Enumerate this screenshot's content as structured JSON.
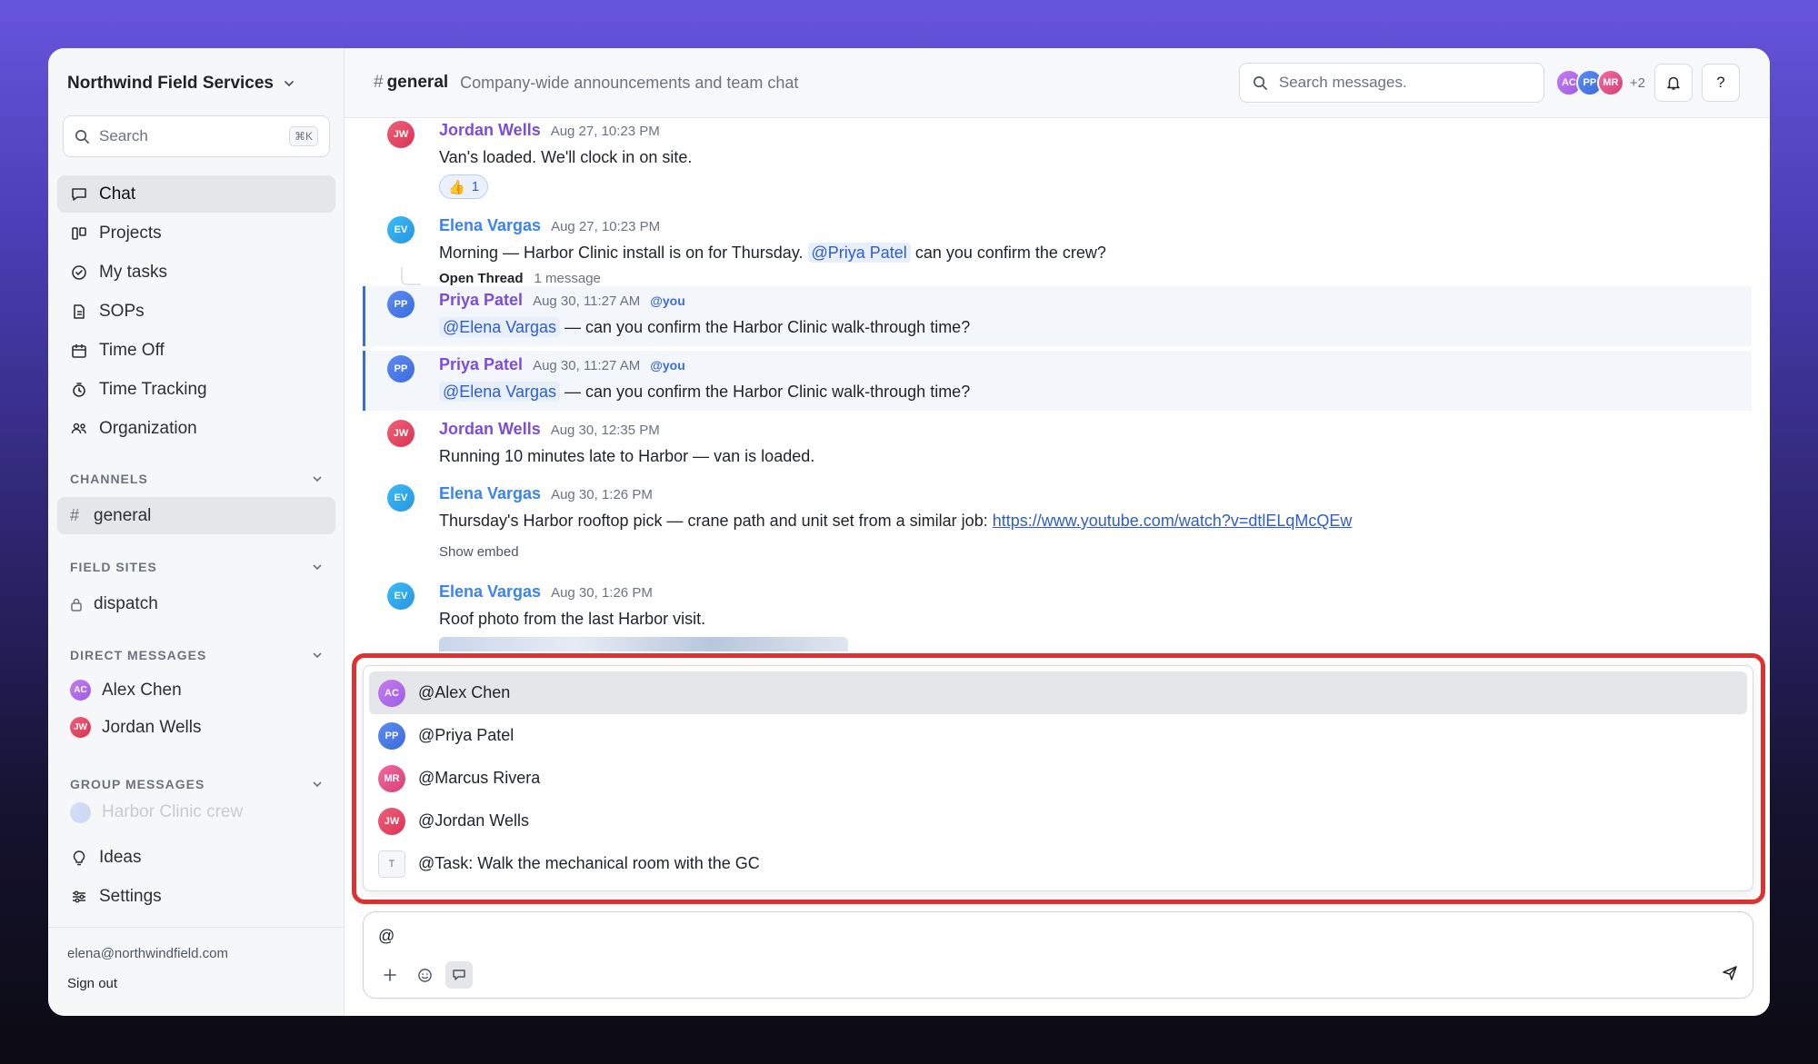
{
  "workspace": {
    "name": "Northwind Field Services"
  },
  "sidebar": {
    "search_placeholder": "Search",
    "search_shortcut": "⌘K",
    "nav": [
      {
        "label": "Chat",
        "icon": "chat-icon"
      },
      {
        "label": "Projects",
        "icon": "projects-icon"
      },
      {
        "label": "My tasks",
        "icon": "tasks-icon"
      },
      {
        "label": "SOPs",
        "icon": "document-icon"
      },
      {
        "label": "Time Off",
        "icon": "calendar-icon"
      },
      {
        "label": "Time Tracking",
        "icon": "timer-icon"
      },
      {
        "label": "Organization",
        "icon": "people-icon"
      }
    ],
    "channels": {
      "title": "CHANNELS",
      "items": [
        {
          "label": "general"
        }
      ]
    },
    "field_sites": {
      "title": "FIELD SITES",
      "items": [
        {
          "label": "dispatch"
        }
      ]
    },
    "direct_messages": {
      "title": "DIRECT MESSAGES",
      "items": [
        {
          "label": "Alex Chen",
          "initials": "AC"
        },
        {
          "label": "Jordan Wells",
          "initials": "JW"
        }
      ]
    },
    "group_messages": {
      "title": "GROUP MESSAGES",
      "items": [
        {
          "label": "Harbor Clinic crew"
        }
      ]
    },
    "bottom_nav": [
      {
        "label": "Ideas",
        "icon": "lightbulb-icon"
      },
      {
        "label": "Settings",
        "icon": "settings-icon"
      }
    ],
    "footer": {
      "email": "elena@northwindfield.com",
      "sign_out": "Sign out"
    }
  },
  "header": {
    "channel": "general",
    "hash": "#",
    "description": "Company-wide announcements and team chat",
    "search_placeholder": "Search messages.",
    "members": [
      "AC",
      "PP",
      "MR"
    ],
    "more_members": "+2",
    "help": "?"
  },
  "messages": [
    {
      "author": "Jordan Wells",
      "initials": "JW",
      "time": "Aug 27, 10:23 PM",
      "text": "Van's loaded. We'll clock in on site.",
      "reaction": {
        "emoji": "👍",
        "count": "1"
      }
    },
    {
      "author": "Elena Vargas",
      "initials": "EV",
      "time": "Aug 27, 10:23 PM",
      "text_before": "Morning — Harbor Clinic install is on for Thursday.",
      "mention": "@Priya Patel",
      "text_after": "can you confirm the crew?",
      "thread_label": "Open Thread",
      "thread_count": "1 message"
    },
    {
      "author": "Priya Patel",
      "initials": "PP",
      "time": "Aug 30, 11:27 AM",
      "you_tag": "@you",
      "mention": "@Elena Vargas",
      "text_after": "— can you confirm the Harbor Clinic walk-through time?"
    },
    {
      "author": "Priya Patel",
      "initials": "PP",
      "time": "Aug 30, 11:27 AM",
      "you_tag": "@you",
      "mention": "@Elena Vargas",
      "text_after": "— can you confirm the Harbor Clinic walk-through time?"
    },
    {
      "author": "Jordan Wells",
      "initials": "JW",
      "time": "Aug 30, 12:35 PM",
      "text": "Running 10 minutes late to Harbor — van is loaded."
    },
    {
      "author": "Elena Vargas",
      "initials": "EV",
      "time": "Aug 30, 1:26 PM",
      "text_before": "Thursday's Harbor rooftop pick — crane path and unit set from a similar job:",
      "link": "https://www.youtube.com/watch?v=dtlELqMcQEw",
      "show_embed": "Show embed"
    },
    {
      "author": "Elena Vargas",
      "initials": "EV",
      "time": "Aug 30, 1:26 PM",
      "text": "Roof photo from the last Harbor visit."
    }
  ],
  "mention_popup": {
    "items": [
      {
        "label": "@Alex Chen",
        "initials": "AC"
      },
      {
        "label": "@Priya Patel",
        "initials": "PP"
      },
      {
        "label": "@Marcus Rivera",
        "initials": "MR"
      },
      {
        "label": "@Jordan Wells",
        "initials": "JW"
      },
      {
        "label": "@Task: Walk the mechanical room with the GC",
        "initials": "T"
      }
    ]
  },
  "composer": {
    "value": "@"
  },
  "colors": {
    "accent": "#3b6be0",
    "author_purple": "#7c4ddb",
    "author_blue": "#3b82f6",
    "highlight_frame": "#e03131"
  }
}
